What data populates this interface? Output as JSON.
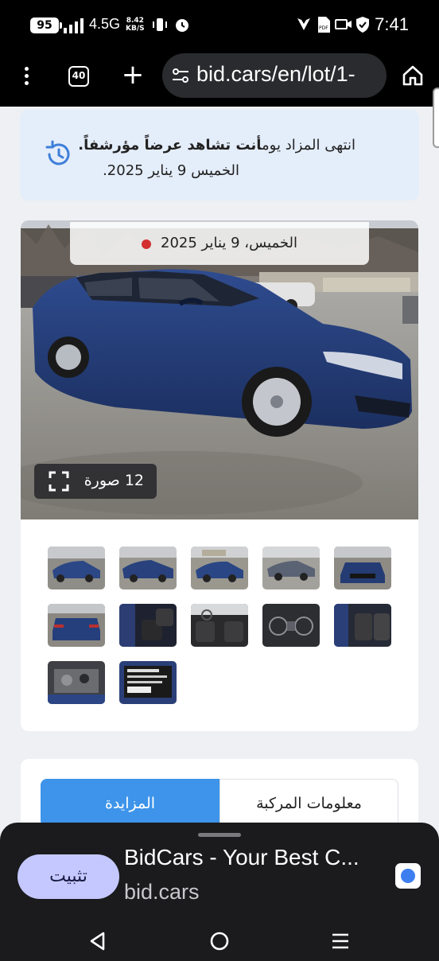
{
  "status_bar": {
    "battery": "95",
    "network": "4.5G",
    "speed_value": "8.42",
    "speed_unit": "KB/S",
    "time": "7:41",
    "icons": [
      "signal-bars-icon",
      "vibrate-icon",
      "alarm-icon",
      "vpn-icon",
      "pdf-icon",
      "camera-icon",
      "shield-icon"
    ]
  },
  "browser": {
    "tab_count": "40",
    "url": "bid.cars/en/lot/1-",
    "icons": [
      "menu-dots-icon",
      "tabs-icon",
      "new-tab-plus-icon",
      "site-settings-icon",
      "home-icon"
    ]
  },
  "notice": {
    "line1_prefix": "انتهى المزاد يوم",
    "line1_bold": "أنت تشاهد عرضاً مؤرشفاً.",
    "line2": "الخميس 9 يناير 2025."
  },
  "gallery": {
    "auction_date": "الخميس، 9 يناير 2025",
    "photo_count_label": "12 صورة",
    "thumbnail_count": 12
  },
  "tabs": {
    "auction": "المزايدة",
    "vehicle_info": "معلومات المركبة"
  },
  "install_sheet": {
    "install_label": "تثبيت",
    "app_title": "BidCars - Your Best C...",
    "app_domain": "bid.cars"
  },
  "colors": {
    "accent_blue": "#3d94ea",
    "notice_bg": "#e4edfa",
    "auction_dot": "#d32f2f",
    "install_button": "#c4c8ff"
  }
}
